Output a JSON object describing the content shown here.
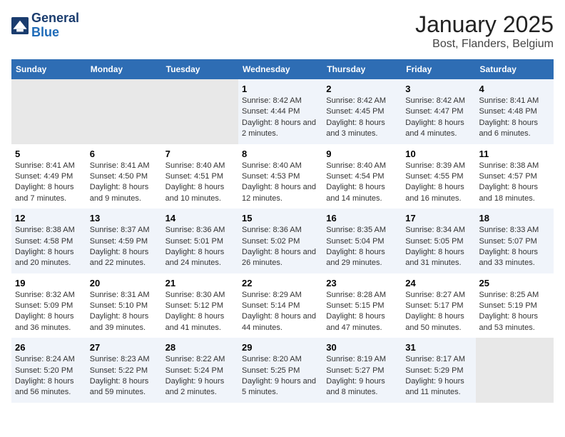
{
  "header": {
    "logo_general": "General",
    "logo_blue": "Blue",
    "title": "January 2025",
    "subtitle": "Bost, Flanders, Belgium"
  },
  "days_of_week": [
    "Sunday",
    "Monday",
    "Tuesday",
    "Wednesday",
    "Thursday",
    "Friday",
    "Saturday"
  ],
  "weeks": [
    {
      "days": [
        {
          "num": "",
          "info": ""
        },
        {
          "num": "",
          "info": ""
        },
        {
          "num": "",
          "info": ""
        },
        {
          "num": "1",
          "info": "Sunrise: 8:42 AM\nSunset: 4:44 PM\nDaylight: 8 hours and 2 minutes."
        },
        {
          "num": "2",
          "info": "Sunrise: 8:42 AM\nSunset: 4:45 PM\nDaylight: 8 hours and 3 minutes."
        },
        {
          "num": "3",
          "info": "Sunrise: 8:42 AM\nSunset: 4:47 PM\nDaylight: 8 hours and 4 minutes."
        },
        {
          "num": "4",
          "info": "Sunrise: 8:41 AM\nSunset: 4:48 PM\nDaylight: 8 hours and 6 minutes."
        }
      ]
    },
    {
      "days": [
        {
          "num": "5",
          "info": "Sunrise: 8:41 AM\nSunset: 4:49 PM\nDaylight: 8 hours and 7 minutes."
        },
        {
          "num": "6",
          "info": "Sunrise: 8:41 AM\nSunset: 4:50 PM\nDaylight: 8 hours and 9 minutes."
        },
        {
          "num": "7",
          "info": "Sunrise: 8:40 AM\nSunset: 4:51 PM\nDaylight: 8 hours and 10 minutes."
        },
        {
          "num": "8",
          "info": "Sunrise: 8:40 AM\nSunset: 4:53 PM\nDaylight: 8 hours and 12 minutes."
        },
        {
          "num": "9",
          "info": "Sunrise: 8:40 AM\nSunset: 4:54 PM\nDaylight: 8 hours and 14 minutes."
        },
        {
          "num": "10",
          "info": "Sunrise: 8:39 AM\nSunset: 4:55 PM\nDaylight: 8 hours and 16 minutes."
        },
        {
          "num": "11",
          "info": "Sunrise: 8:38 AM\nSunset: 4:57 PM\nDaylight: 8 hours and 18 minutes."
        }
      ]
    },
    {
      "days": [
        {
          "num": "12",
          "info": "Sunrise: 8:38 AM\nSunset: 4:58 PM\nDaylight: 8 hours and 20 minutes."
        },
        {
          "num": "13",
          "info": "Sunrise: 8:37 AM\nSunset: 4:59 PM\nDaylight: 8 hours and 22 minutes."
        },
        {
          "num": "14",
          "info": "Sunrise: 8:36 AM\nSunset: 5:01 PM\nDaylight: 8 hours and 24 minutes."
        },
        {
          "num": "15",
          "info": "Sunrise: 8:36 AM\nSunset: 5:02 PM\nDaylight: 8 hours and 26 minutes."
        },
        {
          "num": "16",
          "info": "Sunrise: 8:35 AM\nSunset: 5:04 PM\nDaylight: 8 hours and 29 minutes."
        },
        {
          "num": "17",
          "info": "Sunrise: 8:34 AM\nSunset: 5:05 PM\nDaylight: 8 hours and 31 minutes."
        },
        {
          "num": "18",
          "info": "Sunrise: 8:33 AM\nSunset: 5:07 PM\nDaylight: 8 hours and 33 minutes."
        }
      ]
    },
    {
      "days": [
        {
          "num": "19",
          "info": "Sunrise: 8:32 AM\nSunset: 5:09 PM\nDaylight: 8 hours and 36 minutes."
        },
        {
          "num": "20",
          "info": "Sunrise: 8:31 AM\nSunset: 5:10 PM\nDaylight: 8 hours and 39 minutes."
        },
        {
          "num": "21",
          "info": "Sunrise: 8:30 AM\nSunset: 5:12 PM\nDaylight: 8 hours and 41 minutes."
        },
        {
          "num": "22",
          "info": "Sunrise: 8:29 AM\nSunset: 5:14 PM\nDaylight: 8 hours and 44 minutes."
        },
        {
          "num": "23",
          "info": "Sunrise: 8:28 AM\nSunset: 5:15 PM\nDaylight: 8 hours and 47 minutes."
        },
        {
          "num": "24",
          "info": "Sunrise: 8:27 AM\nSunset: 5:17 PM\nDaylight: 8 hours and 50 minutes."
        },
        {
          "num": "25",
          "info": "Sunrise: 8:25 AM\nSunset: 5:19 PM\nDaylight: 8 hours and 53 minutes."
        }
      ]
    },
    {
      "days": [
        {
          "num": "26",
          "info": "Sunrise: 8:24 AM\nSunset: 5:20 PM\nDaylight: 8 hours and 56 minutes."
        },
        {
          "num": "27",
          "info": "Sunrise: 8:23 AM\nSunset: 5:22 PM\nDaylight: 8 hours and 59 minutes."
        },
        {
          "num": "28",
          "info": "Sunrise: 8:22 AM\nSunset: 5:24 PM\nDaylight: 9 hours and 2 minutes."
        },
        {
          "num": "29",
          "info": "Sunrise: 8:20 AM\nSunset: 5:25 PM\nDaylight: 9 hours and 5 minutes."
        },
        {
          "num": "30",
          "info": "Sunrise: 8:19 AM\nSunset: 5:27 PM\nDaylight: 9 hours and 8 minutes."
        },
        {
          "num": "31",
          "info": "Sunrise: 8:17 AM\nSunset: 5:29 PM\nDaylight: 9 hours and 11 minutes."
        },
        {
          "num": "",
          "info": ""
        }
      ]
    }
  ]
}
